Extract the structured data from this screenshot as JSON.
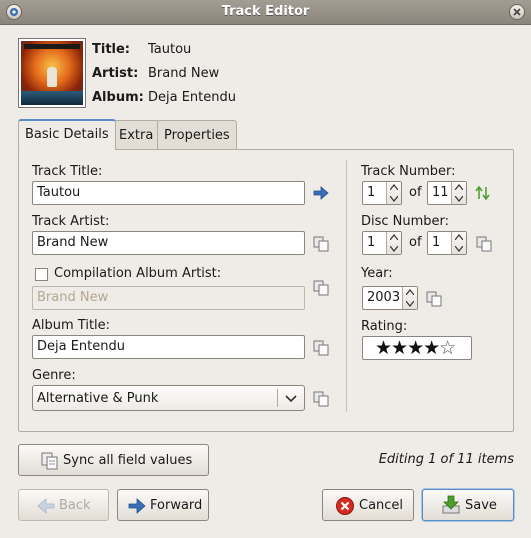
{
  "window": {
    "title": "Track Editor"
  },
  "header": {
    "title_label": "Title:",
    "title_value": "Tautou",
    "artist_label": "Artist:",
    "artist_value": "Brand New",
    "album_label": "Album:",
    "album_value": "Deja Entendu"
  },
  "tabs": [
    {
      "label": "Basic Details"
    },
    {
      "label": "Extra"
    },
    {
      "label": "Properties"
    }
  ],
  "form": {
    "track_title_label": "Track Title:",
    "track_title_value": "Tautou",
    "track_artist_label": "Track Artist:",
    "track_artist_value": "Brand New",
    "compilation_label": "Compilation Album Artist:",
    "compilation_value": "Brand New",
    "compilation_checked": false,
    "album_title_label": "Album Title:",
    "album_title_value": "Deja Entendu",
    "genre_label": "Genre:",
    "genre_value": "Alternative & Punk",
    "track_number_label": "Track Number:",
    "track_number": "1",
    "of_label": "of",
    "track_count": "11",
    "disc_number_label": "Disc Number:",
    "disc_number": "1",
    "disc_of_label": "of",
    "disc_count": "1",
    "year_label": "Year:",
    "year_value": "2003",
    "rating_label": "Rating:",
    "rating_stars": 4,
    "rating_max": 5,
    "stars_on": "★★★★",
    "stars_off": "☆"
  },
  "footer": {
    "sync_label": "Sync all field values",
    "status": "Editing 1 of 11 items",
    "back_label": "Back",
    "forward_label": "Forward",
    "cancel_label": "Cancel",
    "save_label": "Save"
  },
  "colors": {
    "accent": "#5a8bc7",
    "cancel_red": "#d62b22",
    "save_green": "#4b9e2a",
    "arrow_blue": "#3a6fb5"
  }
}
